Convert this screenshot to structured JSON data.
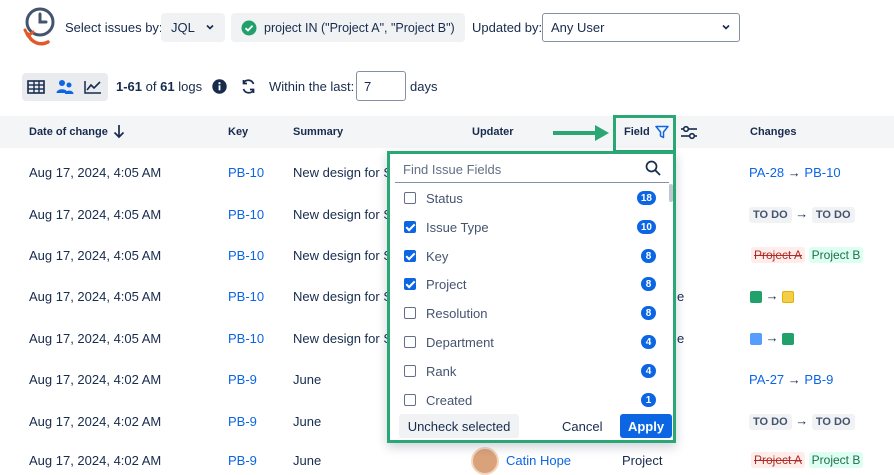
{
  "toolbar": {
    "select_label": "Select issues by:",
    "jql_label": "JQL",
    "query_label": "project IN (\"Project A\", \"Project B\")",
    "updated_by_label": "Updated by:",
    "updated_by_value": "Any User"
  },
  "subbar": {
    "range": "1-61",
    "of": "of",
    "total": "61",
    "logs": "logs",
    "within_label": "Within the last:",
    "days_value": "7",
    "days_unit": "days"
  },
  "table": {
    "headers": {
      "date": "Date of change",
      "key": "Key",
      "summary": "Summary",
      "updater": "Updater",
      "field": "Field",
      "changes": "Changes"
    },
    "rows": [
      {
        "date": "Aug 17, 2024, 4:05 AM",
        "key": "PB-10",
        "summary": "New design for S"
      },
      {
        "date": "Aug 17, 2024, 4:05 AM",
        "key": "PB-10",
        "summary": "New design for S"
      },
      {
        "date": "Aug 17, 2024, 4:05 AM",
        "key": "PB-10",
        "summary": "New design for S"
      },
      {
        "date": "Aug 17, 2024, 4:05 AM",
        "key": "PB-10",
        "summary": "New design for S"
      },
      {
        "date": "Aug 17, 2024, 4:05 AM",
        "key": "PB-10",
        "summary": "New design for S"
      },
      {
        "date": "Aug 17, 2024, 4:02 AM",
        "key": "PB-9",
        "summary": "June"
      },
      {
        "date": "Aug 17, 2024, 4:02 AM",
        "key": "PB-9",
        "summary": "June"
      },
      {
        "date": "Aug 17, 2024, 4:02 AM",
        "key": "PB-9",
        "summary": "June"
      }
    ],
    "partial": {
      "e3": "e",
      "e4": "e",
      "updater_last": "Catin Hope",
      "field_last": "Project"
    },
    "changes": {
      "r1_from": "PA-28",
      "r1_to": "PB-10",
      "r2_from": "TO DO",
      "r2_to": "TO DO",
      "r3_from": "Project A",
      "r3_to": "Project B",
      "r6_from": "PA-27",
      "r6_to": "PB-9",
      "r7_from": "TO DO",
      "r7_to": "TO DO",
      "r8_from": "Project A",
      "r8_to": "Project B"
    }
  },
  "dropdown": {
    "search_placeholder": "Find Issue Fields",
    "items": [
      {
        "label": "Status",
        "checked": false,
        "count": "18"
      },
      {
        "label": "Issue Type",
        "checked": true,
        "count": "10"
      },
      {
        "label": "Key",
        "checked": true,
        "count": "8"
      },
      {
        "label": "Project",
        "checked": true,
        "count": "8"
      },
      {
        "label": "Resolution",
        "checked": false,
        "count": "8"
      },
      {
        "label": "Department",
        "checked": false,
        "count": "4"
      },
      {
        "label": "Rank",
        "checked": false,
        "count": "4"
      },
      {
        "label": "Created",
        "checked": false,
        "count": "1"
      }
    ],
    "uncheck_label": "Uncheck selected",
    "cancel_label": "Cancel",
    "apply_label": "Apply"
  },
  "colors": {
    "accent": "#0c66e4",
    "highlight": "#2aa775"
  }
}
